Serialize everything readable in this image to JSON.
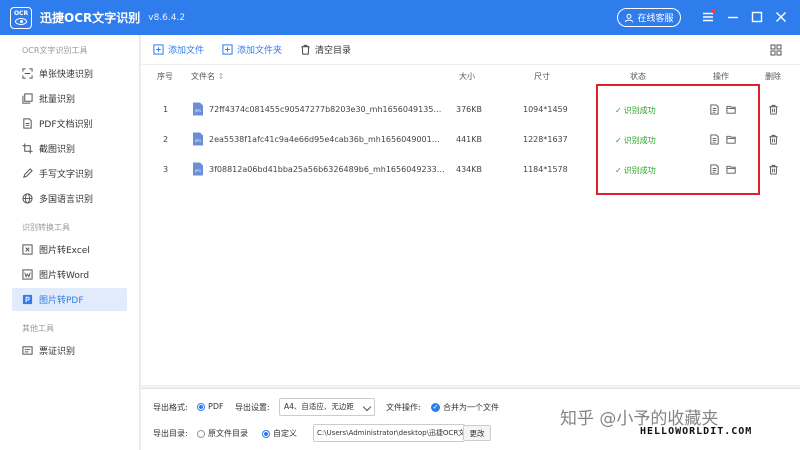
{
  "titlebar": {
    "logo_text": "OCR",
    "title": "迅捷OCR文字识别",
    "version": "v8.6.4.2",
    "service_label": "在线客服"
  },
  "sidebar": {
    "groups": [
      {
        "title": "OCR文字识别工具",
        "items": [
          "单张快速识别",
          "批量识别",
          "PDF文档识别",
          "截图识别",
          "手写文字识别",
          "多国语言识别"
        ]
      },
      {
        "title": "识别转换工具",
        "items": [
          "图片转Excel",
          "图片转Word",
          "图片转PDF"
        ]
      },
      {
        "title": "其他工具",
        "items": [
          "票证识别"
        ]
      }
    ],
    "active": "图片转PDF"
  },
  "toolbar": {
    "add_file": "添加文件",
    "add_folder": "添加文件夹",
    "clear": "清空目录"
  },
  "table": {
    "headers": {
      "index": "序号",
      "name": "文件名",
      "size": "大小",
      "dims": "尺寸",
      "status": "状态",
      "ops": "操作",
      "delete": "删除"
    },
    "rows": [
      {
        "index": "1",
        "name": "72ff4374c081455c90547277b8203e30_mh1656049135…",
        "size": "376KB",
        "dims": "1094*1459",
        "status": "识别成功"
      },
      {
        "index": "2",
        "name": "2ea5538f1afc41c9a4e66d95e4cab36b_mh1656049001…",
        "size": "441KB",
        "dims": "1228*1637",
        "status": "识别成功"
      },
      {
        "index": "3",
        "name": "3f08812a06bd41bba25a56b6326489b6_mh1656049233…",
        "size": "434KB",
        "dims": "1184*1578",
        "status": "识别成功"
      }
    ],
    "file_badge": "JPG"
  },
  "settings": {
    "format_label": "导出格式:",
    "format_value": "PDF",
    "export_label": "导出设置:",
    "export_value": "A4、自适应、无边距",
    "file_op_label": "文件操作:",
    "merge_label": "合并为一个文件",
    "dir_label": "导出目录:",
    "dir_original": "原文件目录",
    "dir_custom": "自定义",
    "path_value": "C:\\Users\\Administrator\\desktop\\迅捷OCR文",
    "change_label": "更改"
  },
  "watermark": {
    "line1": "知乎 @小予的收藏夹",
    "line2": "HELLOWORLDIT.COM"
  }
}
